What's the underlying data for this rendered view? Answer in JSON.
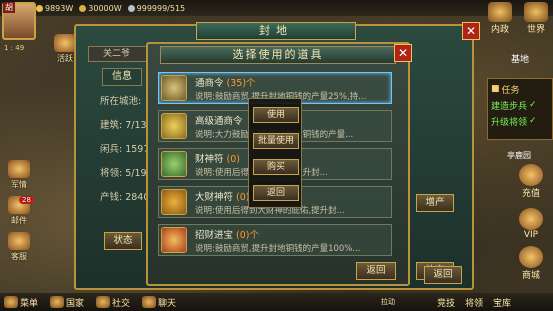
{
  "topbar": {
    "player_tag": "胡",
    "level": "1 : 49",
    "resources": [
      {
        "icon": "coin-icon",
        "value": "9893W",
        "color": "#e8c24a"
      },
      {
        "icon": "food-icon",
        "value": "30000W",
        "color": "#d6b24a"
      },
      {
        "icon": "troop-icon",
        "value": "999999/515",
        "color": "#b8c0c8"
      }
    ]
  },
  "left_menu": [
    {
      "label": "活跃"
    },
    {
      "label": "军情"
    },
    {
      "label": "邮件",
      "badge": "28"
    },
    {
      "label": "客服"
    },
    {
      "label": "菜单"
    }
  ],
  "bottom_menu": {
    "items": [
      "国家",
      "社交",
      "聊天"
    ],
    "right_items": [
      "竞技",
      "将领",
      "宝库"
    ],
    "mini_text": "拉动"
  },
  "right_menu": {
    "icons": [
      {
        "label": "内政"
      },
      {
        "label": "世界"
      }
    ],
    "region_tab": "基地",
    "task": {
      "title": "任务",
      "items": [
        "建造步兵",
        "升级将领"
      ]
    },
    "buttons": [
      {
        "label": "充值"
      },
      {
        "label": "VIP"
      },
      {
        "label": "商城"
      }
    ],
    "map_label": "亭鹿园"
  },
  "fief_dialog": {
    "title": "封地",
    "sub_tab": "关二爷",
    "info_tab": "信息",
    "info_lines": [
      "所在城池:",
      "建筑: 7/13",
      "闲兵: 1597",
      "将领: 5/19",
      "产钱: 2840"
    ],
    "buttons": {
      "status": "状态",
      "build": "增产",
      "abandon": "放弃",
      "back": "返回"
    }
  },
  "item_dialog": {
    "title": "选择使用的道具",
    "items": [
      {
        "name": "通商令",
        "count": "(35)个",
        "desc": "说明:鼓励商贸,提升封地铜钱的产量25%,持..."
      },
      {
        "name": "高级通商令",
        "count": "",
        "desc": "说明:大力鼓励商贸,提升封地铜钱的产量..."
      },
      {
        "name": "财神符",
        "count": "(0)",
        "desc": "说明:使用后得到财神庇佑,提升封..."
      },
      {
        "name": "大财神符",
        "count": "(0)",
        "desc": "说明:使用后得到大财神的庇佑,提升封..."
      },
      {
        "name": "招财进宝",
        "count": "(0)个",
        "desc": "说明:鼓励商贸,提升封地铜钱的产量100%..."
      }
    ],
    "back": "返回"
  },
  "context_menu": {
    "use": "使用",
    "batch_use": "批量使用",
    "buy": "购买",
    "back": "返回"
  }
}
